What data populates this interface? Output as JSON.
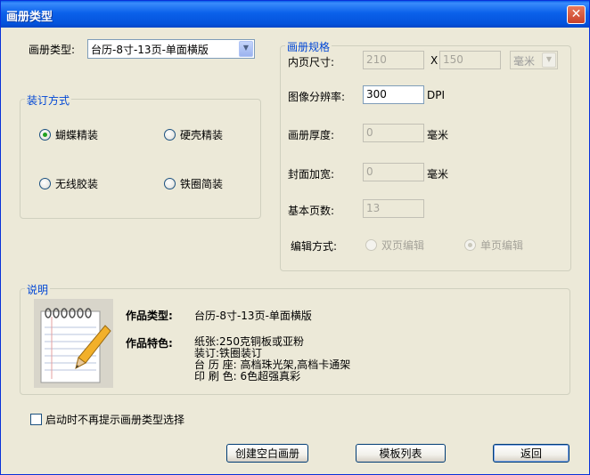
{
  "window": {
    "title": "画册类型",
    "close_icon": "close-icon"
  },
  "album_type": {
    "label": "画册类型:",
    "value": "台历-8寸-13页-单面横版"
  },
  "binding": {
    "title": "装订方式",
    "options": [
      {
        "label": "蝴蝶精装",
        "checked": true
      },
      {
        "label": "硬壳精装",
        "checked": false
      },
      {
        "label": "无线胶装",
        "checked": false
      },
      {
        "label": "铁圈简装",
        "checked": false
      }
    ]
  },
  "spec": {
    "title": "画册规格",
    "page_size_label": "内页尺寸:",
    "width": "210",
    "x_label": "X",
    "height": "150",
    "unit": "毫米",
    "dpi_label": "图像分辨率:",
    "dpi_value": "300",
    "dpi_unit": "DPI",
    "thickness_label": "画册厚度:",
    "thickness_value": "0",
    "thickness_unit": "毫米",
    "cover_label": "封面加宽:",
    "cover_value": "0",
    "cover_unit": "毫米",
    "pages_label": "基本页数:",
    "pages_value": "13",
    "edit_label": "编辑方式:",
    "edit_options": [
      {
        "label": "双页编辑",
        "checked": false
      },
      {
        "label": "单页编辑",
        "checked": true
      }
    ]
  },
  "description": {
    "title": "说明",
    "type_label": "作品类型:",
    "type_value": "台历-8寸-13页-单面横版",
    "feature_label": "作品特色:",
    "features": [
      "纸张:250克铜板或亚粉",
      "装订:铁圈装订",
      "台 历 座: 高档珠光架,高档卡通架",
      "印 刷 色: 6色超强真彩"
    ]
  },
  "dont_show": {
    "label": "启动时不再提示画册类型选择",
    "checked": false
  },
  "buttons": {
    "create": "创建空白画册",
    "templates": "模板列表",
    "back": "返回"
  },
  "colors": {
    "title_bar": "#0a5fe8",
    "group_title": "#0046d5",
    "face": "#ece9d8"
  }
}
